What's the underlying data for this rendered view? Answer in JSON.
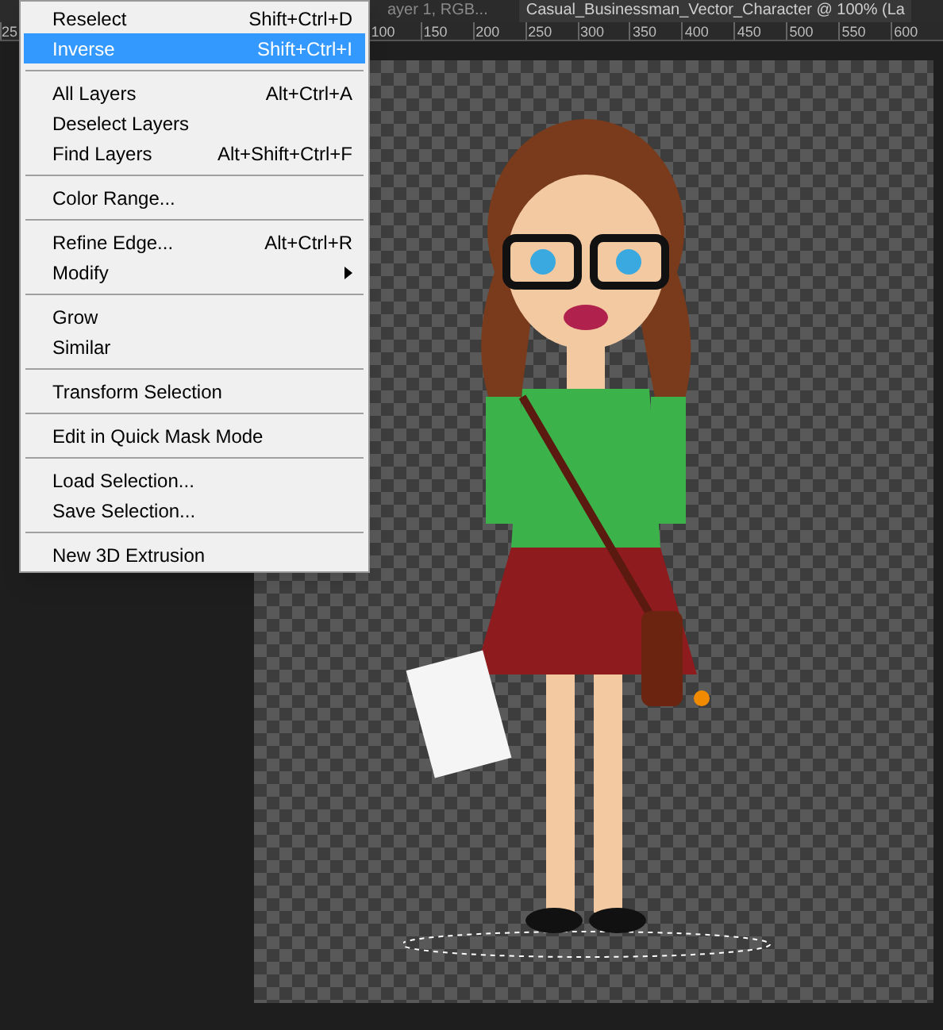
{
  "document_tabs": [
    {
      "label": "ayer 1, RGB...",
      "selected": false
    },
    {
      "label": "Casual_Businessman_Vector_Character @ 100% (La",
      "selected": true
    }
  ],
  "ruler": {
    "labels": [
      "25",
      "100",
      "150",
      "200",
      "250",
      "300",
      "350",
      "400",
      "450",
      "500",
      "550",
      "600"
    ]
  },
  "menu": {
    "items": [
      {
        "kind": "item",
        "label": "Reselect",
        "shortcut": "Shift+Ctrl+D",
        "selected": false
      },
      {
        "kind": "item",
        "label": "Inverse",
        "shortcut": "Shift+Ctrl+I",
        "selected": true
      },
      {
        "kind": "separator"
      },
      {
        "kind": "item",
        "label": "All Layers",
        "shortcut": "Alt+Ctrl+A",
        "selected": false
      },
      {
        "kind": "item",
        "label": "Deselect Layers",
        "selected": false
      },
      {
        "kind": "item",
        "label": "Find Layers",
        "shortcut": "Alt+Shift+Ctrl+F",
        "selected": false
      },
      {
        "kind": "separator"
      },
      {
        "kind": "item",
        "label": "Color Range...",
        "selected": false
      },
      {
        "kind": "separator"
      },
      {
        "kind": "item",
        "label": "Refine Edge...",
        "shortcut": "Alt+Ctrl+R",
        "selected": false
      },
      {
        "kind": "submenu",
        "label": "Modify",
        "selected": false
      },
      {
        "kind": "separator"
      },
      {
        "kind": "item",
        "label": "Grow",
        "selected": false
      },
      {
        "kind": "item",
        "label": "Similar",
        "selected": false
      },
      {
        "kind": "separator"
      },
      {
        "kind": "item",
        "label": "Transform Selection",
        "selected": false
      },
      {
        "kind": "separator"
      },
      {
        "kind": "item",
        "label": "Edit in Quick Mask Mode",
        "selected": false
      },
      {
        "kind": "separator"
      },
      {
        "kind": "item",
        "label": "Load Selection...",
        "selected": false
      },
      {
        "kind": "item",
        "label": "Save Selection...",
        "selected": false
      },
      {
        "kind": "separator"
      },
      {
        "kind": "item",
        "label": "New 3D Extrusion",
        "selected": false
      }
    ]
  }
}
